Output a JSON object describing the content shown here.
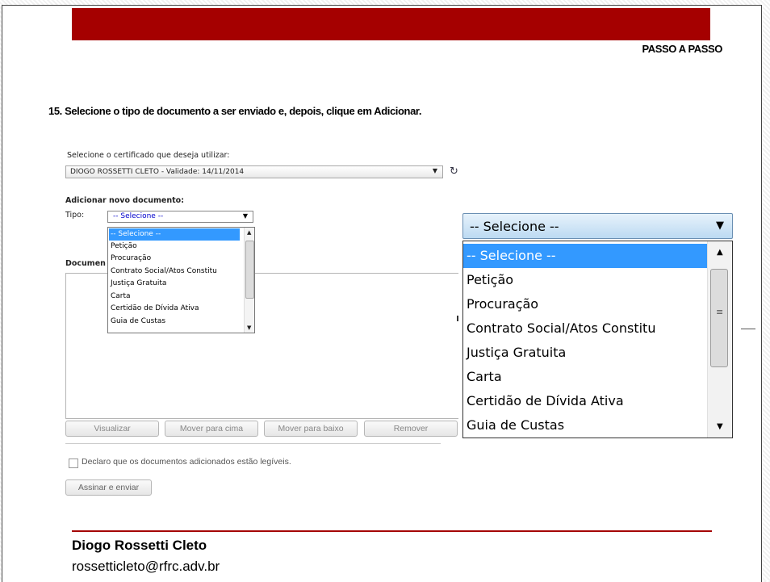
{
  "slide": {
    "section_label": "PASSO A PASSO",
    "instruction": "15. Selecione o tipo de documento a ser enviado e, depois, clique em Adicionar.",
    "accent_color": "#a50000"
  },
  "form": {
    "certificate_label": "Selecione o certificado que deseja utilizar:",
    "certificate_value": "DIOGO ROSSETTI CLETO - Validade: 14/11/2014",
    "refresh_icon": "refresh-icon",
    "add_heading": "Adicionar novo documento:",
    "tipo_label": "Tipo:",
    "tipo_value": "-- Selecione --",
    "documents_label": "Documen",
    "tipo_options": [
      "-- Selecione --",
      "Petição",
      "Procuração",
      "Contrato Social/Atos Constitu",
      "Justiça Gratuita",
      "Carta",
      "Certidão de Dívida Ativa",
      "Guia de Custas"
    ],
    "selected_option_index": 0,
    "buttons": {
      "view": "Visualizar",
      "move_up": "Mover para cima",
      "move_down": "Mover para baixo",
      "remove": "Remover"
    },
    "declare_label": "Declaro que os documentos adicionados estão legíveis.",
    "sign_button": "Assinar e enviar"
  },
  "zoom": {
    "select_value": "-- Selecione --",
    "options": [
      "-- Selecione --",
      "Petição",
      "Procuração",
      "Contrato Social/Atos Constitu",
      "Justiça Gratuita",
      "Carta",
      "Certidão de Dívida Ativa",
      "Guia de Custas"
    ],
    "highlight_color": "#3399ff"
  },
  "footer": {
    "name": "Diogo Rossetti Cleto",
    "email": "rossetticleto@rfrc.adv.br"
  }
}
